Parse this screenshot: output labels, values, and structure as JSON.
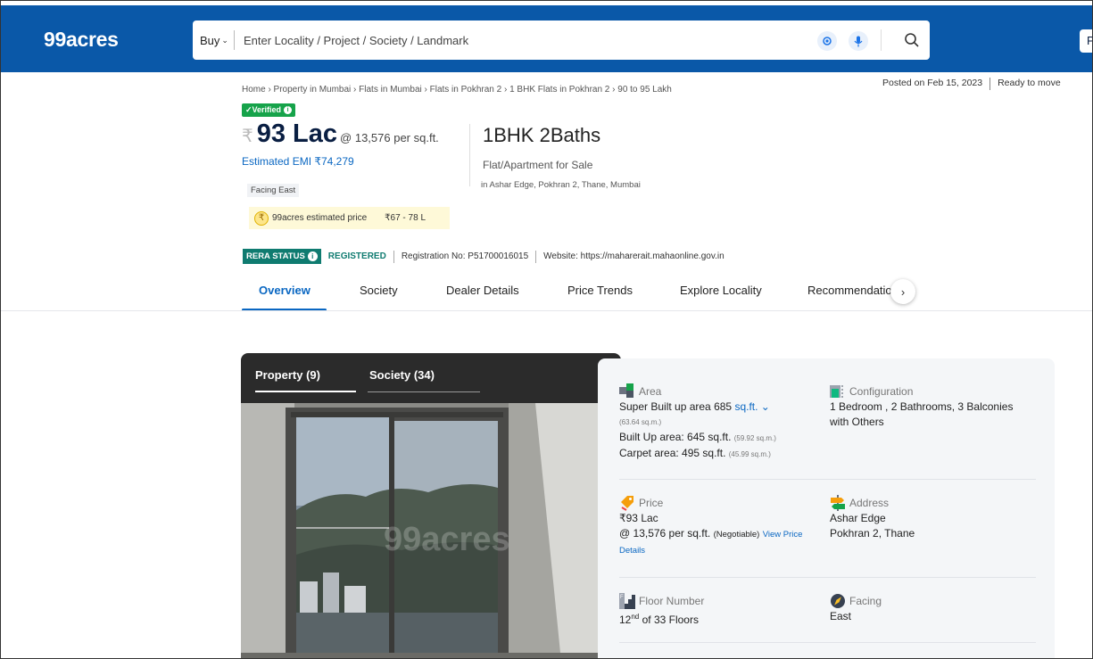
{
  "header": {
    "logo": "99acres",
    "buy_label": "Buy",
    "search_placeholder": "Enter Locality / Project / Society / Landmark",
    "post_label": "P"
  },
  "breadcrumb": "Home › Property in Mumbai › Flats in Mumbai › Flats in Pokhran 2 › 1 BHK Flats in Pokhran 2 › 90 to 95 Lakh",
  "posted_on": "Posted on Feb 15, 2023",
  "possession": "Ready to move",
  "verified_label": "✓Verified",
  "price": {
    "rupee": "₹",
    "amount": "93 Lac",
    "per_sqft": "@ 13,576 per sq.ft.",
    "emi": "Estimated EMI ₹74,279",
    "facing_tag": "Facing East",
    "estimate_label": "99acres estimated price",
    "estimate_range": "₹67 - 78 L"
  },
  "summary": {
    "bhk": "1BHK 2Baths",
    "type": "Flat/Apartment for Sale",
    "location": "in Ashar Edge, Pokhran 2, Thane, Mumbai"
  },
  "rera": {
    "status_label": "RERA STATUS",
    "registered": "REGISTERED",
    "reg_no": "Registration No: P51700016015",
    "website": "Website: https://maharerait.mahaonline.gov.in"
  },
  "tabs": [
    "Overview",
    "Society",
    "Dealer Details",
    "Price Trends",
    "Explore Locality",
    "Recommendatio"
  ],
  "gallery": {
    "tab_property": "Property (9)",
    "tab_society": "Society (34)",
    "watermark": "99acres"
  },
  "details": {
    "area": {
      "label": "Area",
      "super_built": "Super Built up area 685",
      "unit": "sq.ft.",
      "super_sqm": "(63.64 sq.m.)",
      "built_up": "Built Up area: 645 sq.ft.",
      "built_sqm": "(59.92 sq.m.)",
      "carpet": "Carpet area: 495 sq.ft.",
      "carpet_sqm": "(45.99 sq.m.)"
    },
    "configuration": {
      "label": "Configuration",
      "value": "1 Bedroom , 2 Bathrooms, 3 Balconies with Others"
    },
    "price": {
      "label": "Price",
      "value": "₹93 Lac",
      "per_sqft": "@ 13,576 per sq.ft.",
      "negotiable": "(Negotiable)",
      "view_link": "View Price Details"
    },
    "address": {
      "label": "Address",
      "line1": "Ashar Edge",
      "line2": "Pokhran 2, Thane"
    },
    "floor": {
      "label": "Floor Number",
      "value_num": "12",
      "value_sup": "nd",
      "value_rest": "of 33 Floors"
    },
    "facing": {
      "label": "Facing",
      "value": "East"
    }
  },
  "colors": {
    "brand_blue": "#0a58a8",
    "link_blue": "#0a67c2",
    "rera_teal": "#0f7b70",
    "verified_green": "#16a34a"
  }
}
